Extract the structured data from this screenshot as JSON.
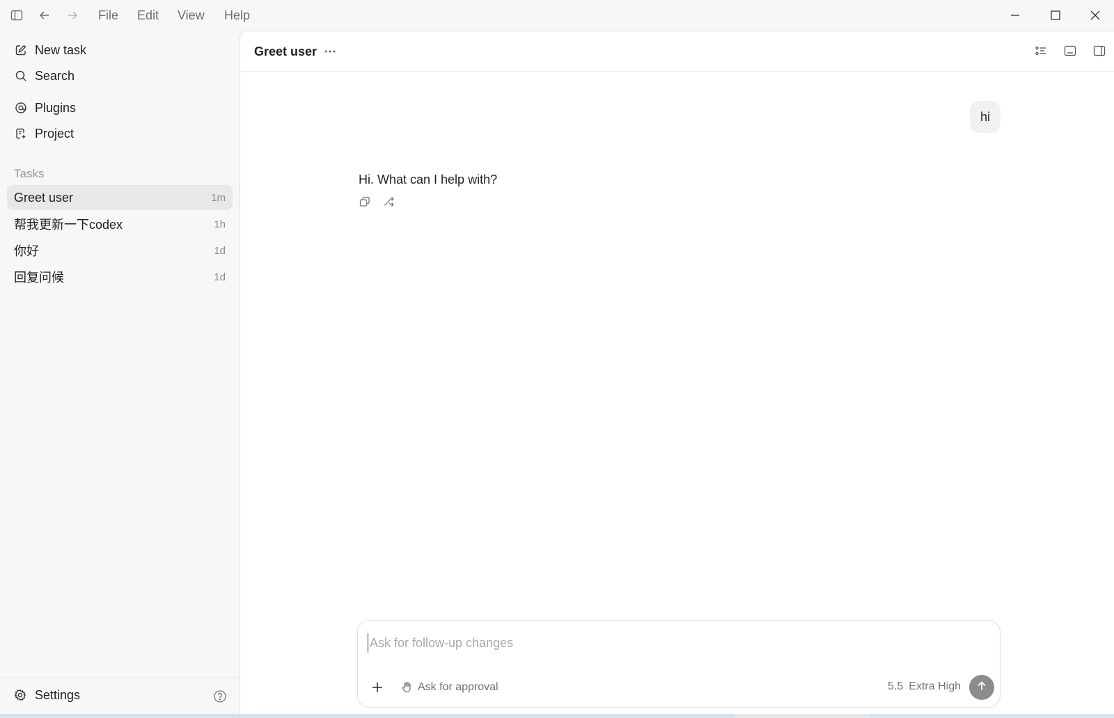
{
  "titlebar": {
    "menu": [
      "File",
      "Edit",
      "View",
      "Help"
    ]
  },
  "sidebar": {
    "nav": [
      {
        "label": "New task",
        "icon": "edit-icon"
      },
      {
        "label": "Search",
        "icon": "search-icon"
      },
      {
        "label": "Plugins",
        "icon": "plugin-icon"
      },
      {
        "label": "Project",
        "icon": "project-icon"
      }
    ],
    "tasks_title": "Tasks",
    "tasks": [
      {
        "label": "Greet user",
        "time": "1m",
        "active": true
      },
      {
        "label": "帮我更新一下codex",
        "time": "1h"
      },
      {
        "label": "你好",
        "time": "1d"
      },
      {
        "label": "回复问候",
        "time": "1d"
      }
    ],
    "settings_label": "Settings"
  },
  "thread": {
    "title": "Greet user",
    "user_message": "hi",
    "assistant_message": "Hi. What can I help with?"
  },
  "composer": {
    "placeholder": "Ask for follow-up changes",
    "approval_label": "Ask for approval",
    "model_version": "5.5",
    "model_effort": "Extra High"
  },
  "colors": {
    "sidebar_bg": "#f7f7f7",
    "active_task_bg": "#e8e8e8",
    "send_button": "#8c8c8c"
  }
}
